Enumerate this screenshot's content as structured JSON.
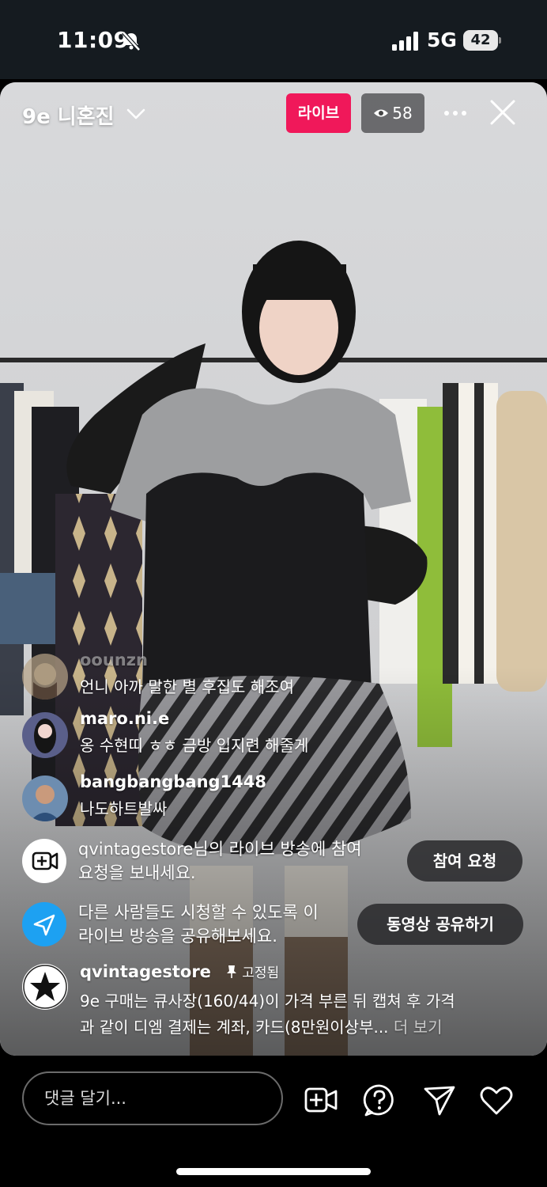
{
  "status_bar": {
    "time": "11:09",
    "network": "5G",
    "battery": "42"
  },
  "live": {
    "host_name": "9e 니혼진",
    "live_badge": "라이브",
    "viewer_count": "58"
  },
  "comments": [
    {
      "user": "oounzn",
      "text": "언니 아까 말한 별 후집도 해조여"
    },
    {
      "user": "maro.ni.e",
      "text": "옹 수현띠 ㅎㅎ 금방 입지련 해줄게"
    },
    {
      "user": "bangbangbang1448",
      "text": "나도하트발싸"
    }
  ],
  "join_request": {
    "text_line1": "qvintagestore님의 라이브 방송에 참여",
    "text_line2": "요청을 보내세요.",
    "button": "참여 요청"
  },
  "share": {
    "text_line1": "다른 사람들도 시청할 수 있도록 이",
    "text_line2": "라이브 방송을 공유해보세요.",
    "button": "동영상 공유하기"
  },
  "pinned": {
    "user": "qvintagestore",
    "tag": "고정됨",
    "text_line1": "9e 구매는 큐사장(160/44)이 가격 부른 뒤 캡쳐 후 가격",
    "text_line2": "과 같이 디엠 결제는 계좌, 카드(8만원이상부...",
    "more": "더 보기"
  },
  "bottom_bar": {
    "comment_placeholder": "댓글 달기..."
  },
  "colors": {
    "live_badge": "#f0185a",
    "share_icon": "#1da1f2",
    "status_bar_bg": "#151b20"
  }
}
